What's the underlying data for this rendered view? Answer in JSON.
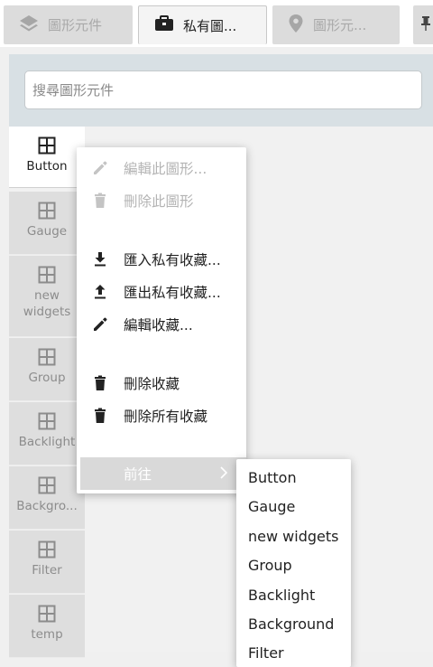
{
  "tabs": [
    {
      "label": "圖形元件",
      "icon": "layers-icon"
    },
    {
      "label": "私有圖...",
      "icon": "briefcase-icon"
    },
    {
      "label": "圖形元...",
      "icon": "map-pin-icon"
    },
    {
      "label": "",
      "icon": "pin-icon"
    }
  ],
  "search": {
    "placeholder": "搜尋圖形元件",
    "value": ""
  },
  "categories": [
    {
      "label": "Button",
      "icon": "grid-icon"
    },
    {
      "label": "Gauge",
      "icon": "grid-icon"
    },
    {
      "label": "new\nwidgets",
      "icon": "grid-icon"
    },
    {
      "label": "Group",
      "icon": "grid-icon"
    },
    {
      "label": "Backlight",
      "icon": "grid-icon"
    },
    {
      "label": "Backgro...",
      "icon": "grid-icon"
    },
    {
      "label": "Filter",
      "icon": "grid-icon"
    },
    {
      "label": "temp",
      "icon": "grid-icon"
    }
  ],
  "context_menu": {
    "items": [
      {
        "label": "編輯此圖形...",
        "icon": "pencil-icon",
        "disabled": true
      },
      {
        "label": "刪除此圖形",
        "icon": "trash-icon",
        "disabled": true
      },
      {
        "label": "匯入私有收藏...",
        "icon": "download-icon",
        "disabled": false
      },
      {
        "label": "匯出私有收藏...",
        "icon": "upload-icon",
        "disabled": false
      },
      {
        "label": "編輯收藏...",
        "icon": "pencil-icon",
        "disabled": false
      },
      {
        "label": "刪除收藏",
        "icon": "trash-icon",
        "disabled": false
      },
      {
        "label": "刪除所有收藏",
        "icon": "trash-icon",
        "disabled": false
      },
      {
        "label": "前往",
        "icon": "chevron-right-icon",
        "highlighted": true
      }
    ]
  },
  "submenu": {
    "items": [
      "Button",
      "Gauge",
      "new widgets",
      "Group",
      "Backlight",
      "Background",
      "Filter"
    ]
  },
  "colors": {
    "search_strip": "#d8e0e4",
    "panel": "#f1f1f1",
    "tab_inactive": "#dcdcdc"
  }
}
